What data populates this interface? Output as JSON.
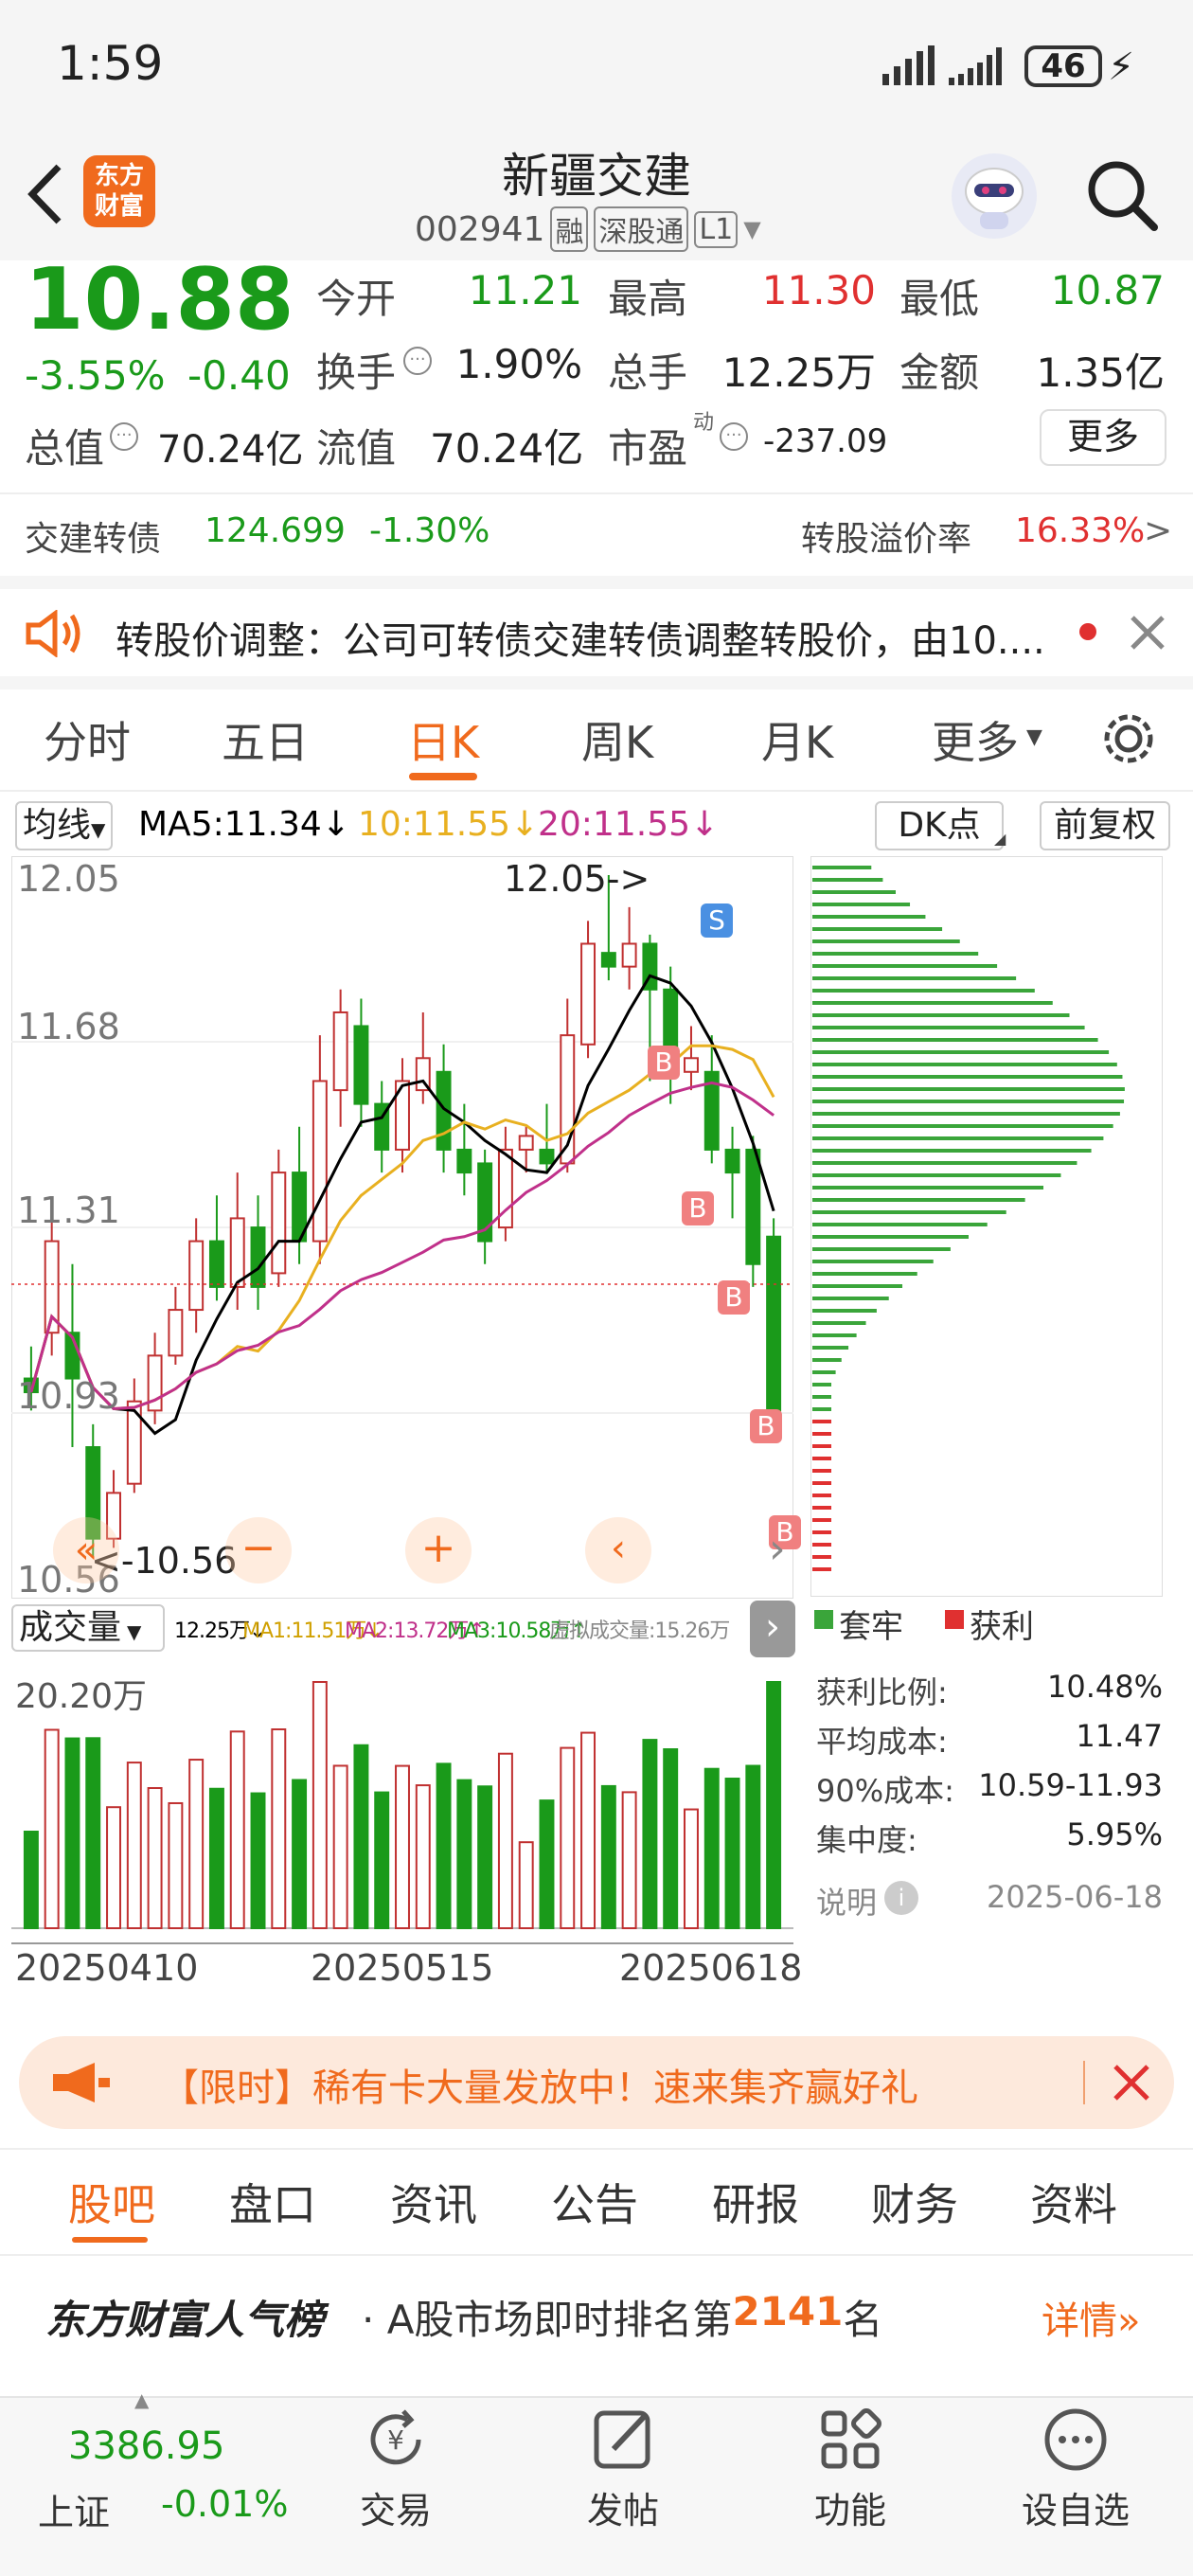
{
  "status": {
    "time": "1:59",
    "battery": "46"
  },
  "header": {
    "title": "新疆交建",
    "code": "002941",
    "badge1": "融",
    "badge2": "深股通",
    "badge3": "L1",
    "logo_text": "东方财富"
  },
  "quote": {
    "price": "10.88",
    "change_pct": "-3.55%",
    "change": "-0.40",
    "rows": [
      {
        "l1": "今开",
        "v1": "11.21",
        "l2": "最高",
        "v2": "11.30",
        "l3": "最低",
        "v3": "10.87"
      },
      {
        "l1": "换手",
        "v1": "1.90%",
        "l2": "总手",
        "v2": "12.25万",
        "l3": "金额",
        "v3": "1.35亿"
      },
      {
        "l1": "总值",
        "v1": "70.24亿",
        "l2": "流值",
        "v2": "70.24亿",
        "l3": "市盈",
        "v3": "-237.09",
        "sup": "动"
      }
    ],
    "more": "更多"
  },
  "bond": {
    "name": "交建转债",
    "price": "124.699",
    "change": "-1.30%",
    "premium_label": "转股溢价率",
    "premium": "16.33%"
  },
  "notice": {
    "text": "转股价调整：公司可转债交建转债调整转股价，由10...."
  },
  "tabs": [
    "分时",
    "五日",
    "日K",
    "周K",
    "月K",
    "更多"
  ],
  "ma_bar": {
    "type": "均线",
    "ma5": "MA5:11.34↓",
    "ma10": "10:11.55↓",
    "ma20": "20:11.55↓",
    "dk": "DK点",
    "adj": "前复权"
  },
  "chart_labels": {
    "p1": "12.05",
    "p2": "11.68",
    "p3": "11.31",
    "p4": "10.93",
    "p5": "10.56",
    "high_note": "12.05->",
    "low_note": "<-10.56"
  },
  "vol_bar": {
    "type": "成交量",
    "vol": "12.25万↓",
    "ma1": "MA1:11.51万↓",
    "ma2": "MA2:13.72万↑",
    "ma3": "MA3:10.58万↑",
    "virt": "虚拟成交量:15.26万",
    "max": "20.20万"
  },
  "dates": [
    "20250410",
    "20250515",
    "20250618"
  ],
  "chip": {
    "legend_loss": "套牢",
    "legend_profit": "获利",
    "rows": [
      {
        "k": "获利比例:",
        "v": "10.48%"
      },
      {
        "k": "平均成本:",
        "v": "11.47"
      },
      {
        "k": "90%成本:",
        "v": "10.59-11.93"
      },
      {
        "k": "集中度:",
        "v": "5.95%"
      }
    ],
    "note": "说明",
    "date": "2025-06-18"
  },
  "ad": {
    "text": "【限时】稀有卡大量发放中！速来集齐赢好礼"
  },
  "bottom_tabs": [
    "股吧",
    "盘口",
    "资讯",
    "公告",
    "研报",
    "财务",
    "资料"
  ],
  "rank": {
    "brand": "东方财富人气榜",
    "prefix": "· A股市场即时排名第",
    "num": "2141",
    "suffix": "名",
    "detail": "详情"
  },
  "nav": {
    "index_val": "3386.95",
    "index_name": "上证",
    "index_chg": "-0.01%",
    "items": [
      "交易",
      "发帖",
      "功能",
      "设自选"
    ]
  },
  "colors": {
    "up": "#e03030",
    "down": "#1a9a1a",
    "accent": "#f06a1d",
    "ma5": "#000000",
    "ma10": "#e8b020",
    "ma20": "#c0308a"
  },
  "chart_data": {
    "type": "candlestick",
    "ylim": [
      10.56,
      12.05
    ],
    "candles": [
      [
        10.95,
        10.92,
        11.02,
        10.88
      ],
      [
        11.05,
        11.25,
        11.3,
        11.0
      ],
      [
        11.05,
        10.95,
        11.2,
        10.8
      ],
      [
        10.8,
        10.6,
        10.85,
        10.56
      ],
      [
        10.6,
        10.7,
        10.75,
        10.58
      ],
      [
        10.72,
        10.9,
        10.95,
        10.7
      ],
      [
        10.88,
        11.0,
        11.05,
        10.85
      ],
      [
        11.0,
        11.1,
        11.15,
        10.98
      ],
      [
        11.1,
        11.25,
        11.3,
        11.05
      ],
      [
        11.25,
        11.15,
        11.35,
        11.12
      ],
      [
        11.15,
        11.3,
        11.4,
        11.1
      ],
      [
        11.28,
        11.15,
        11.35,
        11.1
      ],
      [
        11.18,
        11.4,
        11.45,
        11.15
      ],
      [
        11.4,
        11.25,
        11.5,
        11.2
      ],
      [
        11.25,
        11.6,
        11.7,
        11.2
      ],
      [
        11.58,
        11.75,
        11.8,
        11.5
      ],
      [
        11.72,
        11.55,
        11.78,
        11.5
      ],
      [
        11.55,
        11.45,
        11.6,
        11.4
      ],
      [
        11.45,
        11.6,
        11.65,
        11.4
      ],
      [
        11.58,
        11.65,
        11.75,
        11.55
      ],
      [
        11.62,
        11.45,
        11.68,
        11.4
      ],
      [
        11.45,
        11.4,
        11.55,
        11.35
      ],
      [
        11.42,
        11.25,
        11.45,
        11.2
      ],
      [
        11.28,
        11.45,
        11.5,
        11.25
      ],
      [
        11.45,
        11.48,
        11.5,
        11.4
      ],
      [
        11.45,
        11.42,
        11.55,
        11.4
      ],
      [
        11.42,
        11.7,
        11.78,
        11.4
      ],
      [
        11.68,
        11.9,
        11.95,
        11.65
      ],
      [
        11.88,
        11.85,
        12.05,
        11.82
      ],
      [
        11.85,
        11.9,
        11.98,
        11.8
      ],
      [
        11.9,
        11.8,
        11.92,
        11.6
      ],
      [
        11.8,
        11.62,
        11.85,
        11.55
      ],
      [
        11.62,
        11.65,
        11.72,
        11.58
      ],
      [
        11.62,
        11.45,
        11.7,
        11.42
      ],
      [
        11.45,
        11.4,
        11.5,
        11.3
      ],
      [
        11.45,
        11.2,
        11.48,
        11.15
      ],
      [
        11.26,
        10.88,
        11.3,
        10.87
      ]
    ]
  }
}
